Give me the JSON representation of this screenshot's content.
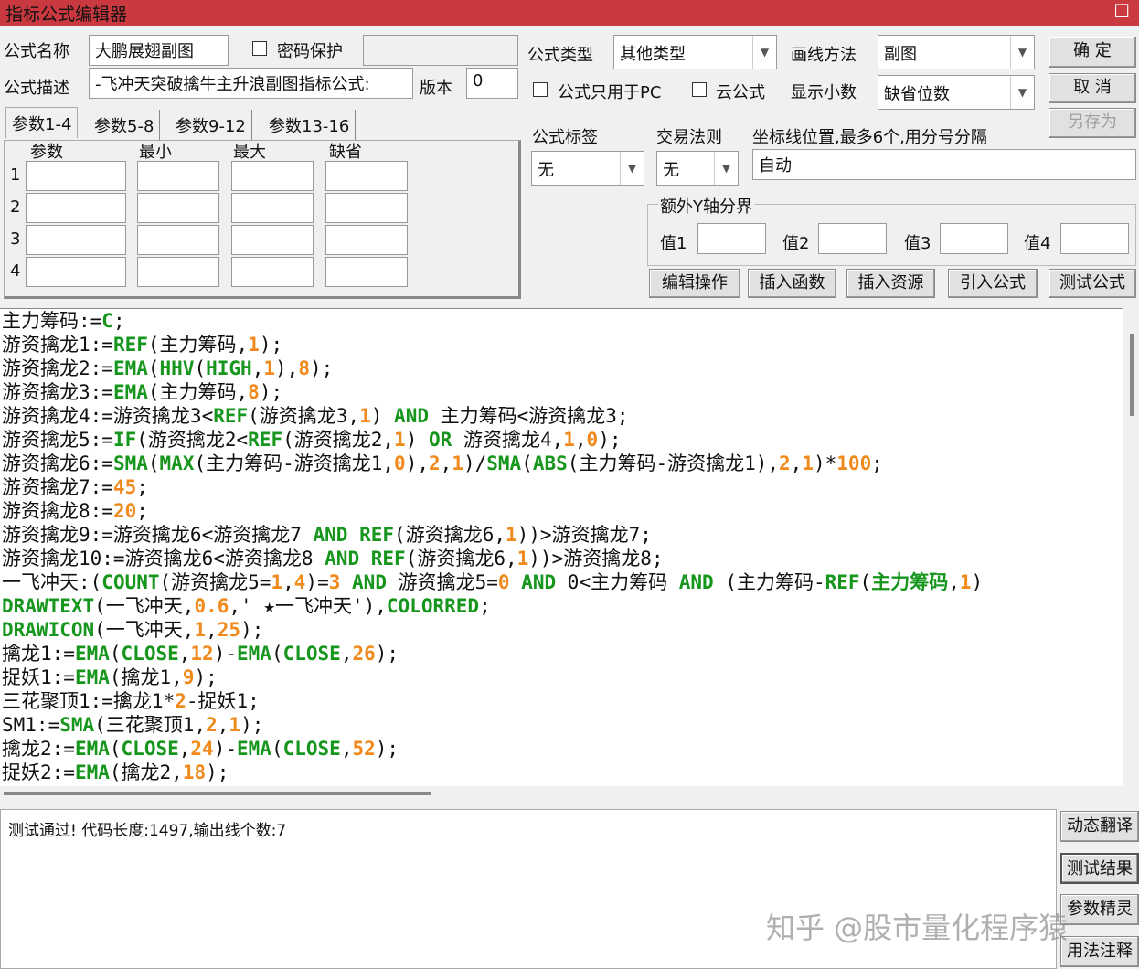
{
  "window": {
    "title": "指标公式编辑器",
    "close": "☐"
  },
  "form": {
    "name_label": "公式名称",
    "name_value": "大鹏展翅副图",
    "password_label": "密码保护",
    "desc_label": "公式描述",
    "desc_value": "-飞冲天突破擒牛主升浪副图指标公式:",
    "version_label": "版本",
    "version_value": "0",
    "type_label": "公式类型",
    "type_value": "其他类型",
    "draw_label": "画线方法",
    "draw_value": "副图",
    "pc_only_label": "公式只用于PC",
    "cloud_label": "云公式",
    "decimal_label": "显示小数",
    "decimal_value": "缺省位数",
    "tag_label": "公式标签",
    "tag_value": "无",
    "rule_label": "交易法则",
    "rule_value": "无",
    "axis_label": "坐标线位置,最多6个,用分号分隔",
    "axis_value": "自动",
    "yaxis_group": "额外Y轴分界",
    "v1": "值1",
    "v2": "值2",
    "v3": "值3",
    "v4": "值4"
  },
  "buttons": {
    "ok": "确  定",
    "cancel": "取  消",
    "saveas": "另存为",
    "edit": "编辑操作",
    "insert_func": "插入函数",
    "insert_res": "插入资源",
    "import": "引入公式",
    "test": "测试公式"
  },
  "tabs": [
    "参数1-4",
    "参数5-8",
    "参数9-12",
    "参数13-16"
  ],
  "param_headers": [
    "参数",
    "最小",
    "最大",
    "缺省"
  ],
  "param_rows": [
    "1",
    "2",
    "3",
    "4"
  ],
  "code": [
    [
      [
        "t",
        "主力筹码:="
      ],
      [
        "k",
        "C"
      ],
      [
        "t",
        ";"
      ]
    ],
    [
      [
        "t",
        "游资擒龙1:="
      ],
      [
        "k",
        "REF"
      ],
      [
        "t",
        "(主力筹码,"
      ],
      [
        "n",
        "1"
      ],
      [
        "t",
        ");"
      ]
    ],
    [
      [
        "t",
        "游资擒龙2:="
      ],
      [
        "k",
        "EMA"
      ],
      [
        "t",
        "("
      ],
      [
        "k",
        "HHV"
      ],
      [
        "t",
        "("
      ],
      [
        "k",
        "HIGH"
      ],
      [
        "t",
        ","
      ],
      [
        "n",
        "1"
      ],
      [
        "t",
        "),"
      ],
      [
        "n",
        "8"
      ],
      [
        "t",
        ");"
      ]
    ],
    [
      [
        "t",
        "游资擒龙3:="
      ],
      [
        "k",
        "EMA"
      ],
      [
        "t",
        "(主力筹码,"
      ],
      [
        "n",
        "8"
      ],
      [
        "t",
        ");"
      ]
    ],
    [
      [
        "t",
        "游资擒龙4:=游资擒龙3<"
      ],
      [
        "k",
        "REF"
      ],
      [
        "t",
        "(游资擒龙3,"
      ],
      [
        "n",
        "1"
      ],
      [
        "t",
        ") "
      ],
      [
        "k",
        "AND"
      ],
      [
        "t",
        " 主力筹码<游资擒龙3;"
      ]
    ],
    [
      [
        "t",
        "游资擒龙5:="
      ],
      [
        "k",
        "IF"
      ],
      [
        "t",
        "(游资擒龙2<"
      ],
      [
        "k",
        "REF"
      ],
      [
        "t",
        "(游资擒龙2,"
      ],
      [
        "n",
        "1"
      ],
      [
        "t",
        ") "
      ],
      [
        "k",
        "OR"
      ],
      [
        "t",
        " 游资擒龙4,"
      ],
      [
        "n",
        "1"
      ],
      [
        "t",
        ","
      ],
      [
        "n",
        "0"
      ],
      [
        "t",
        ");"
      ]
    ],
    [
      [
        "t",
        "游资擒龙6:="
      ],
      [
        "k",
        "SMA"
      ],
      [
        "t",
        "("
      ],
      [
        "k",
        "MAX"
      ],
      [
        "t",
        "(主力筹码-游资擒龙1,"
      ],
      [
        "n",
        "0"
      ],
      [
        "t",
        "),"
      ],
      [
        "n",
        "2"
      ],
      [
        "t",
        ","
      ],
      [
        "n",
        "1"
      ],
      [
        "t",
        ")/"
      ],
      [
        "k",
        "SMA"
      ],
      [
        "t",
        "("
      ],
      [
        "k",
        "ABS"
      ],
      [
        "t",
        "(主力筹码-游资擒龙1),"
      ],
      [
        "n",
        "2"
      ],
      [
        "t",
        ","
      ],
      [
        "n",
        "1"
      ],
      [
        "t",
        ")*"
      ],
      [
        "n",
        "100"
      ],
      [
        "t",
        ";"
      ]
    ],
    [
      [
        "t",
        "游资擒龙7:="
      ],
      [
        "n",
        "45"
      ],
      [
        "t",
        ";"
      ]
    ],
    [
      [
        "t",
        "游资擒龙8:="
      ],
      [
        "n",
        "20"
      ],
      [
        "t",
        ";"
      ]
    ],
    [
      [
        "t",
        "游资擒龙9:=游资擒龙6<游资擒龙7 "
      ],
      [
        "k",
        "AND"
      ],
      [
        "t",
        " "
      ],
      [
        "k",
        "REF"
      ],
      [
        "t",
        "(游资擒龙6,"
      ],
      [
        "n",
        "1"
      ],
      [
        "t",
        "))>游资擒龙7;"
      ]
    ],
    [
      [
        "t",
        "游资擒龙10:=游资擒龙6<游资擒龙8 "
      ],
      [
        "k",
        "AND"
      ],
      [
        "t",
        " "
      ],
      [
        "k",
        "REF"
      ],
      [
        "t",
        "(游资擒龙6,"
      ],
      [
        "n",
        "1"
      ],
      [
        "t",
        "))>游资擒龙8;"
      ]
    ],
    [
      [
        "t",
        "一飞冲天:("
      ],
      [
        "k",
        "COUNT"
      ],
      [
        "t",
        "(游资擒龙5="
      ],
      [
        "n",
        "1"
      ],
      [
        "t",
        ","
      ],
      [
        "n",
        "4"
      ],
      [
        "t",
        ")="
      ],
      [
        "n",
        "3"
      ],
      [
        "t",
        " "
      ],
      [
        "k",
        "AND"
      ],
      [
        "t",
        " 游资擒龙5="
      ],
      [
        "n",
        "0"
      ],
      [
        "t",
        " "
      ],
      [
        "k",
        "AND"
      ],
      [
        "t",
        " 0<主力筹码 "
      ],
      [
        "k",
        "AND"
      ],
      [
        "t",
        " (主力筹码-"
      ],
      [
        "k",
        "REF"
      ],
      [
        "t",
        "("
      ],
      [
        "k",
        "主力筹码"
      ],
      [
        "t",
        ","
      ],
      [
        "n",
        "1"
      ],
      [
        "t",
        ")"
      ]
    ],
    [
      [
        "k",
        "DRAWTEXT"
      ],
      [
        "t",
        "(一飞冲天,"
      ],
      [
        "n",
        "0.6"
      ],
      [
        "t",
        ",' ★一飞冲天'),"
      ],
      [
        "k",
        "COLORRED"
      ],
      [
        "t",
        ";"
      ]
    ],
    [
      [
        "k",
        "DRAWICON"
      ],
      [
        "t",
        "(一飞冲天,"
      ],
      [
        "n",
        "1"
      ],
      [
        "t",
        ","
      ],
      [
        "n",
        "25"
      ],
      [
        "t",
        ");"
      ]
    ],
    [
      [
        "t",
        "擒龙1:="
      ],
      [
        "k",
        "EMA"
      ],
      [
        "t",
        "("
      ],
      [
        "k",
        "CLOSE"
      ],
      [
        "t",
        ","
      ],
      [
        "n",
        "12"
      ],
      [
        "t",
        ")-"
      ],
      [
        "k",
        "EMA"
      ],
      [
        "t",
        "("
      ],
      [
        "k",
        "CLOSE"
      ],
      [
        "t",
        ","
      ],
      [
        "n",
        "26"
      ],
      [
        "t",
        ");"
      ]
    ],
    [
      [
        "t",
        "捉妖1:="
      ],
      [
        "k",
        "EMA"
      ],
      [
        "t",
        "(擒龙1,"
      ],
      [
        "n",
        "9"
      ],
      [
        "t",
        ");"
      ]
    ],
    [
      [
        "t",
        "三花聚顶1:=擒龙1*"
      ],
      [
        "n",
        "2"
      ],
      [
        "t",
        "-捉妖1;"
      ]
    ],
    [
      [
        "t",
        "SM1:="
      ],
      [
        "k",
        "SMA"
      ],
      [
        "t",
        "(三花聚顶1,"
      ],
      [
        "n",
        "2"
      ],
      [
        "t",
        ","
      ],
      [
        "n",
        "1"
      ],
      [
        "t",
        ");"
      ]
    ],
    [
      [
        "t",
        "擒龙2:="
      ],
      [
        "k",
        "EMA"
      ],
      [
        "t",
        "("
      ],
      [
        "k",
        "CLOSE"
      ],
      [
        "t",
        ","
      ],
      [
        "n",
        "24"
      ],
      [
        "t",
        ")-"
      ],
      [
        "k",
        "EMA"
      ],
      [
        "t",
        "("
      ],
      [
        "k",
        "CLOSE"
      ],
      [
        "t",
        ","
      ],
      [
        "n",
        "52"
      ],
      [
        "t",
        ");"
      ]
    ],
    [
      [
        "t",
        "捉妖2:="
      ],
      [
        "k",
        "EMA"
      ],
      [
        "t",
        "(擒龙2,"
      ],
      [
        "n",
        "18"
      ],
      [
        "t",
        ");"
      ]
    ]
  ],
  "output": {
    "message": "测试通过! 代码长度:1497,输出线个数:7"
  },
  "side_buttons": [
    "动态翻译",
    "测试结果",
    "参数精灵",
    "用法注释"
  ],
  "watermark": "知乎 @股市量化程序猿",
  "colors": {
    "titlebar": "#c9393f",
    "keyword": "#16961c",
    "number": "#f08a1c"
  }
}
